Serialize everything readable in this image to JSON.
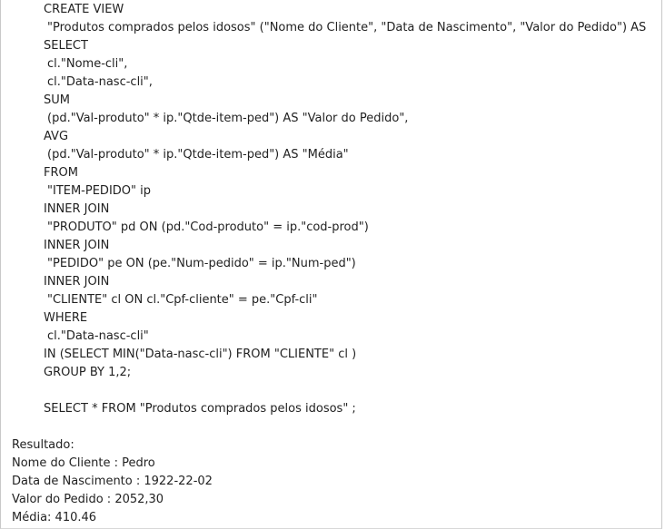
{
  "sql": {
    "create_view": "CREATE VIEW",
    "view_definition": "\"Produtos comprados pelos idosos\" (\"Nome do Cliente\", \"Data de Nascimento\", \"Valor do Pedido\") AS",
    "select_kw": "SELECT",
    "col_nome": "cl.\"Nome-cli\",",
    "col_data": "cl.\"Data-nasc-cli\",",
    "sum_kw": "SUM",
    "sum_expr": "(pd.\"Val-produto\" * ip.\"Qtde-item-ped\") AS \"Valor do Pedido\",",
    "avg_kw": "AVG",
    "avg_expr": "(pd.\"Val-produto\" * ip.\"Qtde-item-ped\") AS \"Média\"",
    "from_kw": "FROM",
    "from_table": "\"ITEM-PEDIDO\" ip",
    "join1_kw": "INNER JOIN",
    "join1_expr": "\"PRODUTO\" pd ON (pd.\"Cod-produto\" = ip.\"cod-prod\")",
    "join2_kw": "INNER JOIN",
    "join2_expr": "\"PEDIDO\" pe ON (pe.\"Num-pedido\" = ip.\"Num-ped\")",
    "join3_kw": "INNER JOIN",
    "join3_expr": "\"CLIENTE\" cl ON cl.\"Cpf-cliente\" = pe.\"Cpf-cli\"",
    "where_kw": "WHERE",
    "where_col": "cl.\"Data-nasc-cli\"",
    "in_subquery": "IN (SELECT MIN(\"Data-nasc-cli\") FROM \"CLIENTE\" cl )",
    "group_by": "GROUP BY 1,2;",
    "select_view": "SELECT * FROM \"Produtos comprados pelos idosos\" ;"
  },
  "result": {
    "heading": "Resultado:",
    "nome": "Nome do Cliente : Pedro",
    "data_nascimento": "Data de Nascimento : 1922-22-02",
    "valor_pedido": "Valor do Pedido : 2052,30",
    "media": "Média: 410.46"
  }
}
